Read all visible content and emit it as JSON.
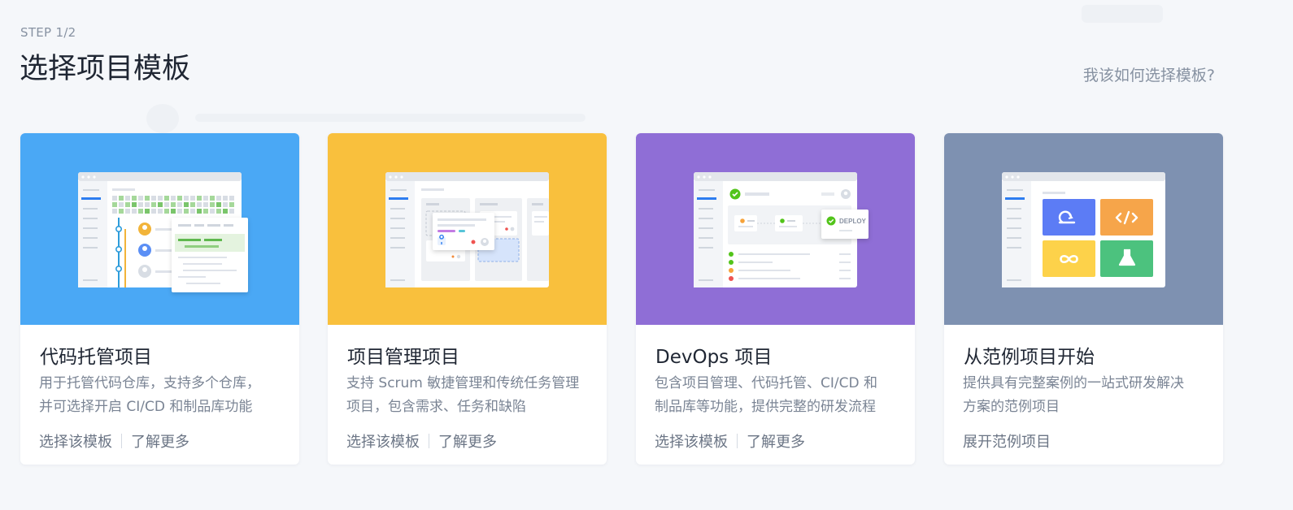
{
  "header": {
    "step": "STEP 1/2",
    "title": "选择项目模板",
    "help_link": "我该如何选择模板?"
  },
  "templates": [
    {
      "name": "代码托管项目",
      "desc_line1": "用于托管代码仓库，支持多个仓库，",
      "desc_line2": "并可选择开启 CI/CD 和制品库功能",
      "primary_action": "选择该模板",
      "secondary_action": "了解更多",
      "color": "#4aa8f5"
    },
    {
      "name": "项目管理项目",
      "desc_line1": "支持 Scrum 敏捷管理和传统任务管理",
      "desc_line2": "项目，包含需求、任务和缺陷",
      "primary_action": "选择该模板",
      "secondary_action": "了解更多",
      "color": "#f9c03d"
    },
    {
      "name": "DevOps 项目",
      "desc_line1": "包含项目管理、代码托管、CI/CD 和",
      "desc_line2": "制品库等功能，提供完整的研发流程",
      "primary_action": "选择该模板",
      "secondary_action": "了解更多",
      "color": "#8f6ed6",
      "illustration_badge": "DEPLOY"
    },
    {
      "name": "从范例项目开始",
      "desc_line1": "提供具有完整案例的一站式研发解决",
      "desc_line2": "方案的范例项目",
      "primary_action": "展开范例项目",
      "color": "#7e91b1"
    }
  ],
  "colors": {
    "page_bg": "#f5f7fa",
    "text_dark": "#1f2633",
    "text_muted": "#7a8494"
  }
}
